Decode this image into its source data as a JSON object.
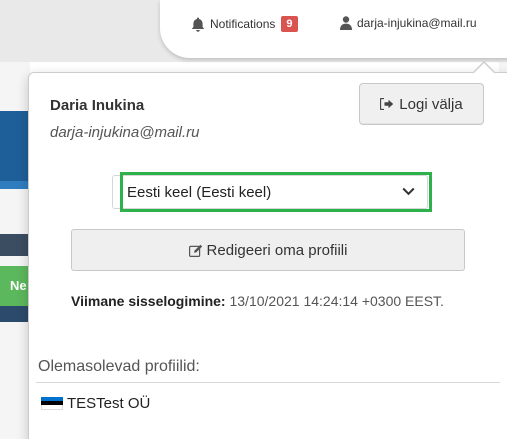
{
  "navbar": {
    "notifications_label": "Notifications",
    "notifications_count": "9",
    "user_email": "darja-injukina@mail.ru"
  },
  "background": {
    "green_button_text": "Ne"
  },
  "dropdown": {
    "user_name": "Daria Inukina",
    "user_email": "darja-injukina@mail.ru",
    "logout_label": "Logi välja",
    "language_selected": "Eesti keel (Eesti keel)",
    "edit_profile_label": "Redigeeri oma profiili",
    "last_login_label": "Viimane sisselogimine:",
    "last_login_value": "13/10/2021 14:24:14 +0300 EEST.",
    "profiles_heading": "Olemasolevad profiilid:",
    "profiles": [
      {
        "name": "TESTest OÜ",
        "flag_icon": "estonia-flag-icon"
      }
    ]
  },
  "colors": {
    "badge": "#d9534f",
    "highlight_outline": "#2db14a",
    "brand_blue": "#1f5f99",
    "flag_blue": "#0072ce"
  }
}
